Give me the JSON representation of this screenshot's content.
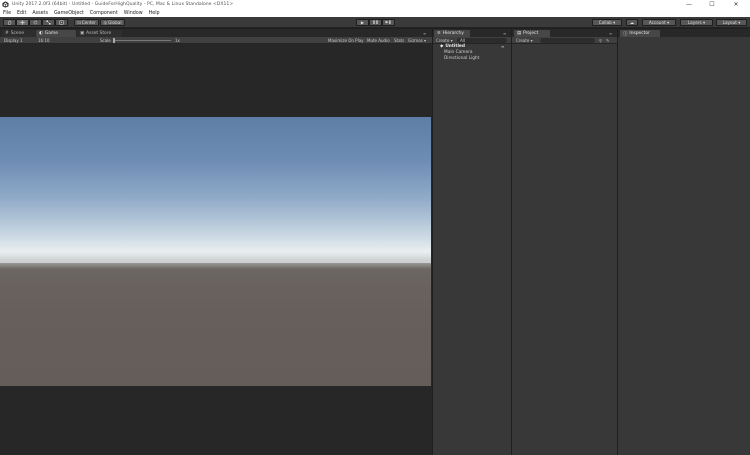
{
  "window": {
    "title": "Unity 2017.2.0f3 (64bit) - Untitled - GuideForHighQuality - PC, Mac & Linux Standalone <DX11>",
    "minimize": "—",
    "maximize": "☐",
    "close": "✕"
  },
  "menu": {
    "items": [
      "File",
      "Edit",
      "Assets",
      "GameObject",
      "Component",
      "Window",
      "Help"
    ]
  },
  "toolbar": {
    "pivot_label": "Center",
    "space_label": "Global",
    "collab_label": "Collab ▾",
    "account_label": "Account ▾",
    "layers_label": "Layers ▾",
    "layout_label": "Layout ▾",
    "play_icon": "▶",
    "pause_icon": "❚❚",
    "step_icon": "▶❚",
    "cloud_icon": "☁"
  },
  "scene_panel": {
    "tabs": [
      "Scene",
      "Game",
      "Asset Store"
    ],
    "display": "Display 1",
    "aspect": "16:10",
    "scale_label": "Scale",
    "scale_value": "1x",
    "maximize_on_play": "Maximize On Play",
    "mute_audio": "Mute Audio",
    "stats": "Stats",
    "gizmos": "Gizmos ▾"
  },
  "hierarchy": {
    "tab": "Hierarchy",
    "create": "Create ▾",
    "search_placeholder": "All",
    "scene_name": "Untitled",
    "items": [
      "Main Camera",
      "Directional Light"
    ]
  },
  "project": {
    "tab": "Project",
    "create": "Create ▾"
  },
  "inspector": {
    "tab": "Inspector"
  },
  "colors": {
    "editor_bg": "#383838",
    "toolbar_bg": "#3a3a3a",
    "sky_top": "#5e7ea7",
    "horizon": "#e9eef0",
    "ground": "#645d59"
  }
}
